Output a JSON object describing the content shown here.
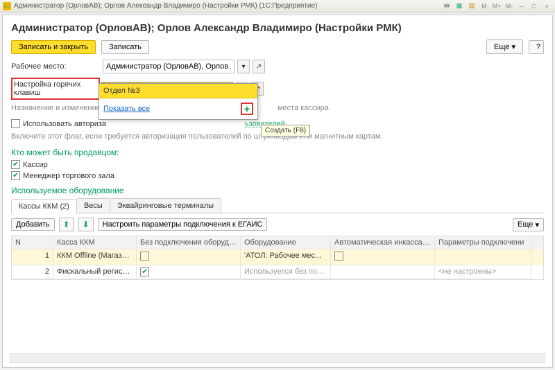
{
  "titlebar": {
    "text": "Администратор (ОрловАВ); Орлов Александр Владимиро (Настройки РМК)  (1С:Предприятие)",
    "buttons_right": [
      "M",
      "M+",
      "M-",
      "–",
      "□",
      "×"
    ]
  },
  "header": "Администратор (ОрловАВ); Орлов Александр Владимиро (Настройки РМК)",
  "buttons": {
    "write_close": "Записать и закрыть",
    "write": "Записать",
    "more": "Еще",
    "help": "?",
    "add": "Добавить",
    "configure_egais": "Настроить параметры подключения к ЕГАИС"
  },
  "fields": {
    "workplace_label": "Рабочее место:",
    "workplace_value": "Администратор (ОрловАВ), Орлов Алекс",
    "hotkeys_label": "Настройка горячих клавиш",
    "hotkeys_value": "Отдел №3"
  },
  "hint_text_before": "Назначение и изменение гор",
  "hint_text_after": "места кассира.",
  "auth_label_before": "Использовать авториза",
  "auth_label_after": "ьзователей",
  "auth_hint": "Включите этот флаг, если требуется авторизация пользователей по штрихкодам или магнитным картам.",
  "seller_section": "Кто может быть продавцом:",
  "seller_opts": {
    "cashier": "Кассир",
    "hall_manager": "Менеджер торгового зала"
  },
  "equip_section": "Используемое оборудование",
  "tabs": {
    "kkm": "Кассы ККМ (2)",
    "scales": "Весы",
    "acquiring": "Эквайринговые терминалы"
  },
  "table": {
    "columns": [
      "N",
      "Касса ККМ",
      "Без подключения оборудования",
      "Оборудование",
      "Автоматическая инкассация",
      "Параметры подключени"
    ],
    "rows": [
      {
        "n": "1",
        "kkm": "ККМ Offline (Магазин...",
        "noconn": false,
        "equip": "'АТОЛ: Рабочее мес...",
        "autoink": false,
        "params": ""
      },
      {
        "n": "2",
        "kkm": "Фискальный регистр...",
        "noconn": true,
        "equip": "Используется без по...",
        "autoink": "",
        "params": "<не настроены>"
      }
    ]
  },
  "dropdown": {
    "header": "Отдел №3",
    "show_all": "Показать все",
    "tooltip": "Создать (F8)"
  },
  "colors": {
    "accent": "#ffdd2d",
    "green": "#009966",
    "link": "#1166cc",
    "highlight": "#d33"
  }
}
